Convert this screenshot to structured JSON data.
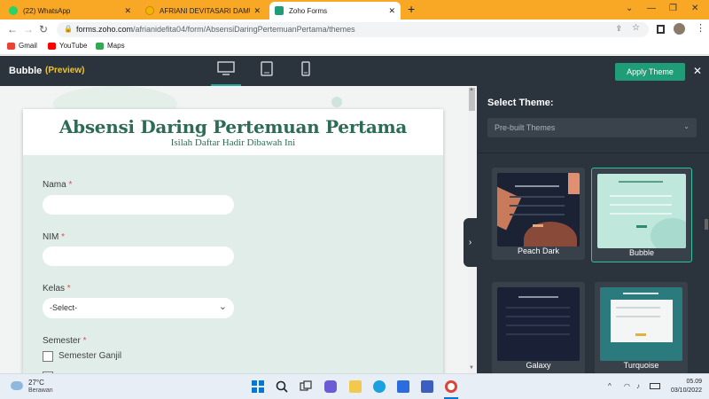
{
  "browser": {
    "tabs": [
      {
        "label": "(22) WhatsApp",
        "icon": "whatsapp-icon",
        "active": false
      },
      {
        "label": "AFRIANI DEVITASARI DAMULAWAN",
        "icon": "google-slides-icon",
        "active": false
      },
      {
        "label": "Zoho Forms",
        "icon": "zoho-forms-icon",
        "active": true
      }
    ],
    "new_tab": "+",
    "window_controls": {
      "chevron": "⌄",
      "minimize": "—",
      "restore": "❐",
      "close": "✕"
    },
    "url_host": "forms.zoho.com",
    "url_path": "/afrianidefita04/form/AbsensiDaringPertemuanPertama/themes",
    "bookmarks": [
      "Gmail",
      "YouTube",
      "Maps"
    ]
  },
  "zoho": {
    "title": "Bubble",
    "preview_label": "(Preview)",
    "apply_button": "Apply Theme",
    "close": "✕",
    "devices": [
      "desktop-icon",
      "tablet-icon",
      "mobile-icon"
    ],
    "active_device": "desktop-icon"
  },
  "form": {
    "title": "Absensi Daring Pertemuan Pertama",
    "subtitle": "Isilah Daftar Hadir Dibawah Ini",
    "required_mark": "*",
    "fields": {
      "nama": "Nama",
      "nim": "NIM",
      "kelas": "Kelas",
      "kelas_value": "-Select-",
      "semester": "Semester",
      "semester_option": "Semester Ganjil"
    }
  },
  "theme_panel": {
    "heading": "Select Theme:",
    "dropdown_value": "Pre-built Themes",
    "themes": [
      {
        "name": "Peach Dark",
        "selected": false,
        "color": "#1b2233"
      },
      {
        "name": "Bubble",
        "selected": true,
        "color": "#bfe7dc"
      },
      {
        "name": "Galaxy",
        "selected": false,
        "color": "#1a2035"
      },
      {
        "name": "Turquoise",
        "selected": false,
        "color": "#2a7a7e"
      }
    ],
    "collapse_arrow": "›"
  },
  "taskbar": {
    "temperature": "27°C",
    "weather": "Berawan",
    "time": "05.09",
    "date": "03/10/2022",
    "tray_arrow": "^"
  },
  "colors": {
    "chrome_tabstrip": "#f9a825",
    "zoho_header": "#2b333d",
    "apply_button": "#1f9d78",
    "form_title": "#2e6b57",
    "form_body": "#e1ede8",
    "selected_border": "#29c3a4"
  }
}
